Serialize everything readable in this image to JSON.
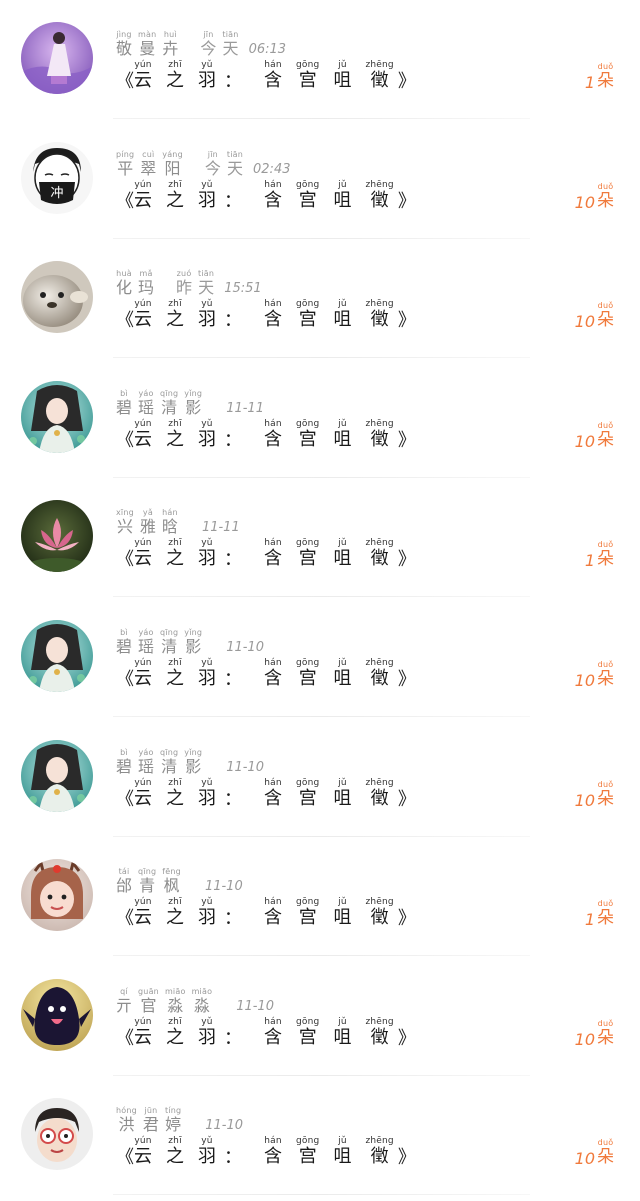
{
  "gift_records": {
    "title_parts": {
      "open": "《",
      "work": [
        {
          "py": "yún",
          "hz": "云"
        },
        {
          "py": "zhī",
          "hz": "之"
        },
        {
          "py": "yǔ",
          "hz": "羽"
        }
      ],
      "colon": "：",
      "sub": [
        {
          "py": "hán",
          "hz": "含"
        },
        {
          "py": "gōng",
          "hz": "宫"
        },
        {
          "py": "jǔ",
          "hz": "咀"
        },
        {
          "py": "zhēng",
          "hz": "徵"
        }
      ],
      "close": "》"
    },
    "unit": {
      "py": "duǒ",
      "hz": "朵"
    },
    "colors": {
      "accent": "#f07a3c",
      "muted": "#9a9a9a"
    },
    "rows": [
      {
        "avatar": "avatar-lavender-girl",
        "name": [
          {
            "py": "jìng",
            "hz": "敬"
          },
          {
            "py": "màn",
            "hz": "曼"
          },
          {
            "py": "huì",
            "hz": "卉"
          }
        ],
        "date": [
          {
            "py": "jīn",
            "hz": "今"
          },
          {
            "py": "tiān",
            "hz": "天"
          }
        ],
        "time": "06:13",
        "count": "1"
      },
      {
        "avatar": "avatar-masked-boy",
        "name": [
          {
            "py": "píng",
            "hz": "平"
          },
          {
            "py": "cuì",
            "hz": "翠"
          },
          {
            "py": "yáng",
            "hz": "阳"
          }
        ],
        "date": [
          {
            "py": "jīn",
            "hz": "今"
          },
          {
            "py": "tiān",
            "hz": "天"
          }
        ],
        "time": "02:43",
        "count": "10"
      },
      {
        "avatar": "avatar-seal",
        "name": [
          {
            "py": "huà",
            "hz": "化"
          },
          {
            "py": "mǎ",
            "hz": "玛"
          }
        ],
        "date": [
          {
            "py": "zuó",
            "hz": "昨"
          },
          {
            "py": "tiān",
            "hz": "天"
          }
        ],
        "time": "15:51",
        "count": "10"
      },
      {
        "avatar": "avatar-fantasy-girl",
        "name": [
          {
            "py": "bì",
            "hz": "碧"
          },
          {
            "py": "yáo",
            "hz": "瑶"
          },
          {
            "py": "qīng",
            "hz": "清"
          },
          {
            "py": "yǐng",
            "hz": "影"
          }
        ],
        "date": [],
        "time": "11-11",
        "count": "10"
      },
      {
        "avatar": "avatar-lotus",
        "name": [
          {
            "py": "xīng",
            "hz": "兴"
          },
          {
            "py": "yǎ",
            "hz": "雅"
          },
          {
            "py": "hán",
            "hz": "晗"
          }
        ],
        "date": [],
        "time": "11-11",
        "count": "1"
      },
      {
        "avatar": "avatar-fantasy-girl",
        "name": [
          {
            "py": "bì",
            "hz": "碧"
          },
          {
            "py": "yáo",
            "hz": "瑶"
          },
          {
            "py": "qīng",
            "hz": "清"
          },
          {
            "py": "yǐng",
            "hz": "影"
          }
        ],
        "date": [],
        "time": "11-10",
        "count": "10"
      },
      {
        "avatar": "avatar-fantasy-girl",
        "name": [
          {
            "py": "bì",
            "hz": "碧"
          },
          {
            "py": "yáo",
            "hz": "瑶"
          },
          {
            "py": "qīng",
            "hz": "清"
          },
          {
            "py": "yǐng",
            "hz": "影"
          }
        ],
        "date": [],
        "time": "11-10",
        "count": "10"
      },
      {
        "avatar": "avatar-reindeer-kid",
        "name": [
          {
            "py": "tái",
            "hz": "邰"
          },
          {
            "py": "qīng",
            "hz": "青"
          },
          {
            "py": "fēng",
            "hz": "枫"
          }
        ],
        "date": [],
        "time": "11-10",
        "count": "1"
      },
      {
        "avatar": "avatar-plush-toy",
        "name": [
          {
            "py": "qí",
            "hz": "亓"
          },
          {
            "py": "guān",
            "hz": "官"
          },
          {
            "py": "miāo",
            "hz": "淼"
          },
          {
            "py": "miāo",
            "hz": "淼"
          }
        ],
        "date": [],
        "time": "11-10",
        "count": "10"
      },
      {
        "avatar": "avatar-glasses-boy",
        "name": [
          {
            "py": "hóng",
            "hz": "洪"
          },
          {
            "py": "jūn",
            "hz": "君"
          },
          {
            "py": "tíng",
            "hz": "婷"
          }
        ],
        "date": [],
        "time": "11-10",
        "count": "10"
      }
    ]
  }
}
